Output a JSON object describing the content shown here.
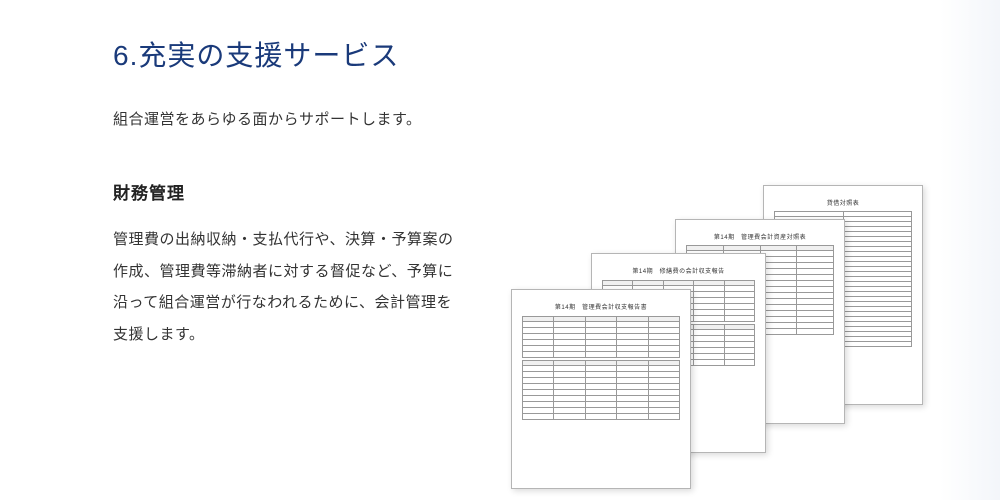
{
  "section": {
    "title": "6.充実の支援サービス",
    "lead": "組合運営をあらゆる面からサポートします。"
  },
  "subsection": {
    "title": "財務管理",
    "body": "管理費の出納収納・支払代行や、決算・予算案の作成、管理費等滞納者に対する督促など、予算に沿って組合運営が行なわれるために、会計管理を支援します。"
  },
  "documents": {
    "doc1": {
      "title": "第14期　管理費会計収支報告書",
      "sub": ""
    },
    "doc2": {
      "title": "第14期　修繕費の会計収支報告",
      "sub": ""
    },
    "doc3": {
      "title": "第14期　管理費会計資産対照表",
      "sub": ""
    },
    "doc4": {
      "title": "貸借対照表",
      "sub": ""
    }
  }
}
